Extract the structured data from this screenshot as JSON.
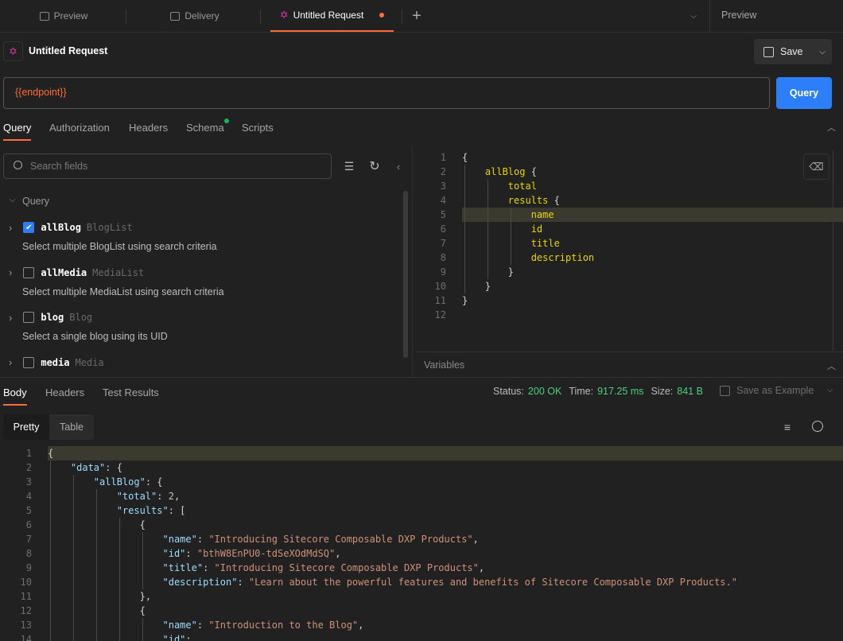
{
  "tabs": [
    {
      "label": "Preview",
      "icon": "preview-icon"
    },
    {
      "label": "Delivery",
      "icon": "preview-icon"
    },
    {
      "label": "Untitled Request",
      "icon": "graphql-icon",
      "active": true,
      "unsaved": true
    }
  ],
  "right_pane_label": "Preview",
  "request": {
    "title": "Untitled Request",
    "save_label": "Save",
    "url": "{{endpoint}}",
    "query_button": "Query"
  },
  "request_tabs": [
    {
      "label": "Query",
      "active": true
    },
    {
      "label": "Authorization"
    },
    {
      "label": "Headers"
    },
    {
      "label": "Schema",
      "dot": true
    },
    {
      "label": "Scripts"
    }
  ],
  "explorer": {
    "search_placeholder": "Search fields",
    "root": "Query",
    "items": [
      {
        "name": "allBlog",
        "type": "BlogList",
        "checked": true,
        "desc": "Select multiple BlogList using search criteria"
      },
      {
        "name": "allMedia",
        "type": "MediaList",
        "checked": false,
        "desc": "Select multiple MediaList using search criteria"
      },
      {
        "name": "blog",
        "type": "Blog",
        "checked": false,
        "desc": "Select a single blog using its UID"
      },
      {
        "name": "media",
        "type": "Media",
        "checked": false,
        "desc": ""
      }
    ]
  },
  "query_editor": {
    "highlight_line": 5,
    "lines": [
      {
        "i": 0,
        "t": [
          [
            "{",
            "b"
          ]
        ]
      },
      {
        "i": 1,
        "t": [
          [
            "allBlog ",
            "y"
          ],
          [
            "{",
            "b"
          ]
        ]
      },
      {
        "i": 2,
        "t": [
          [
            "total",
            "y"
          ]
        ]
      },
      {
        "i": 2,
        "t": [
          [
            "results ",
            "y"
          ],
          [
            "{",
            "b"
          ]
        ]
      },
      {
        "i": 3,
        "t": [
          [
            "name",
            "y"
          ]
        ]
      },
      {
        "i": 3,
        "t": [
          [
            "id",
            "y"
          ]
        ]
      },
      {
        "i": 3,
        "t": [
          [
            "title",
            "y"
          ]
        ]
      },
      {
        "i": 3,
        "t": [
          [
            "description",
            "y"
          ]
        ]
      },
      {
        "i": 2,
        "t": [
          [
            "}",
            "b"
          ]
        ]
      },
      {
        "i": 1,
        "t": [
          [
            "}",
            "b"
          ]
        ]
      },
      {
        "i": 0,
        "t": [
          [
            "}",
            "b"
          ]
        ]
      },
      {
        "i": 0,
        "t": []
      }
    ]
  },
  "variables_label": "Variables",
  "response": {
    "tabs": [
      {
        "label": "Body",
        "active": true
      },
      {
        "label": "Headers"
      },
      {
        "label": "Test Results"
      }
    ],
    "status_label": "Status:",
    "status": "200 OK",
    "time_label": "Time:",
    "time": "917.25 ms",
    "size_label": "Size:",
    "size": "841 B",
    "save_example": "Save as Example",
    "views": [
      {
        "label": "Pretty",
        "active": true
      },
      {
        "label": "Table"
      }
    ],
    "highlight_line": 1,
    "lines": [
      {
        "i": 0,
        "t": [
          [
            "{",
            "b"
          ]
        ]
      },
      {
        "i": 1,
        "t": [
          [
            "\"data\"",
            "k"
          ],
          [
            ": {",
            "p"
          ]
        ]
      },
      {
        "i": 2,
        "t": [
          [
            "\"allBlog\"",
            "k"
          ],
          [
            ": {",
            "p"
          ]
        ]
      },
      {
        "i": 3,
        "t": [
          [
            "\"total\"",
            "k"
          ],
          [
            ": ",
            "p"
          ],
          [
            "2",
            "n"
          ],
          [
            ",",
            "p"
          ]
        ]
      },
      {
        "i": 3,
        "t": [
          [
            "\"results\"",
            "k"
          ],
          [
            ": [",
            "p"
          ]
        ]
      },
      {
        "i": 4,
        "t": [
          [
            "{",
            "b"
          ]
        ]
      },
      {
        "i": 5,
        "t": [
          [
            "\"name\"",
            "k"
          ],
          [
            ": ",
            "p"
          ],
          [
            "\"Introducing Sitecore Composable DXP Products\"",
            "s"
          ],
          [
            ",",
            "p"
          ]
        ]
      },
      {
        "i": 5,
        "t": [
          [
            "\"id\"",
            "k"
          ],
          [
            ": ",
            "p"
          ],
          [
            "\"bthW8EnPU0-tdSeXOdMdSQ\"",
            "s"
          ],
          [
            ",",
            "p"
          ]
        ]
      },
      {
        "i": 5,
        "t": [
          [
            "\"title\"",
            "k"
          ],
          [
            ": ",
            "p"
          ],
          [
            "\"Introducing Sitecore Composable DXP Products\"",
            "s"
          ],
          [
            ",",
            "p"
          ]
        ]
      },
      {
        "i": 5,
        "t": [
          [
            "\"description\"",
            "k"
          ],
          [
            ": ",
            "p"
          ],
          [
            "\"Learn about the powerful features and benefits of Sitecore Composable DXP Products.\"",
            "s"
          ]
        ]
      },
      {
        "i": 4,
        "t": [
          [
            "},",
            "b"
          ]
        ]
      },
      {
        "i": 4,
        "t": [
          [
            "{",
            "b"
          ]
        ]
      },
      {
        "i": 5,
        "t": [
          [
            "\"name\"",
            "k"
          ],
          [
            ": ",
            "p"
          ],
          [
            "\"Introduction to the Blog\"",
            "s"
          ],
          [
            ",",
            "p"
          ]
        ]
      },
      {
        "i": 5,
        "t": [
          [
            "\"id\"",
            "k"
          ],
          [
            ": ",
            "p"
          ]
        ]
      }
    ]
  },
  "colors": {
    "accent": "#ff6c37",
    "primary": "#2d7ff9",
    "success": "#49d17d",
    "graphql": "#e535ab"
  }
}
